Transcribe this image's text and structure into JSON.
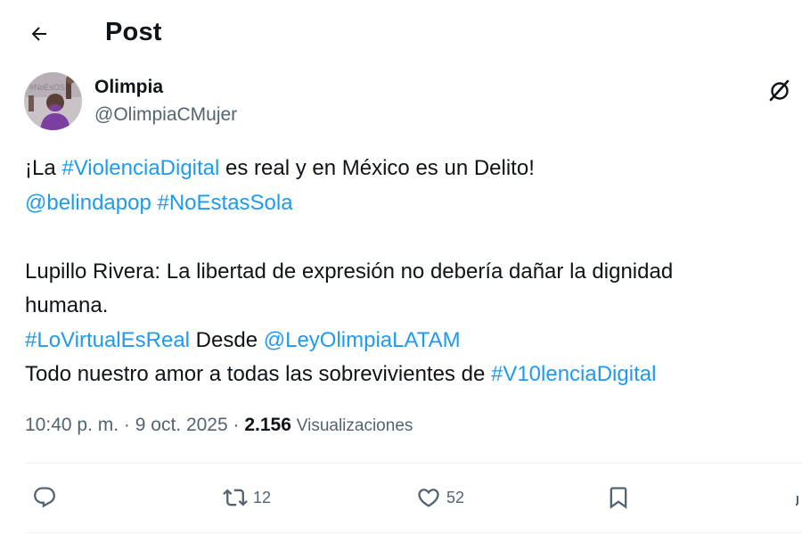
{
  "header": {
    "title": "Post",
    "back_icon": "arrow-left-icon"
  },
  "author": {
    "name": "Olimpia",
    "handle": "@OlimpiaCMujer",
    "avatar_overlay": "#NoEsOS"
  },
  "tweet": {
    "l1_pre": "¡La ",
    "l1_tag": "#ViolenciaDigital",
    "l1_post": " es real y en México es un Delito!",
    "l2_mention": "@belindapop",
    "l2_tag": "#NoEstasSola",
    "l4": "Lupillo Rivera: La libertad de expresión no debería dañar la dignidad",
    "l5": "humana.",
    "l6_tag": "#LoVirtualEsReal",
    "l6_mid": " Desde ",
    "l6_mention": "@LeyOlimpiaLATAM",
    "l7_pre": "Todo nuestro amor a todas las sobrevivientes de ",
    "l7_tag": "#V10lenciaDigital"
  },
  "meta": {
    "time": "10:40 p. m.",
    "date": "9 oct. 2025",
    "views_count": "2.156",
    "views_label": "Visualizaciones"
  },
  "actions": {
    "reply_count": "",
    "retweet_count": "12",
    "like_count": "52"
  },
  "colors": {
    "link": "#1d9bf0",
    "text": "#0f1419",
    "secondary": "#536471",
    "avatar_accent": "#7b3fa0"
  }
}
